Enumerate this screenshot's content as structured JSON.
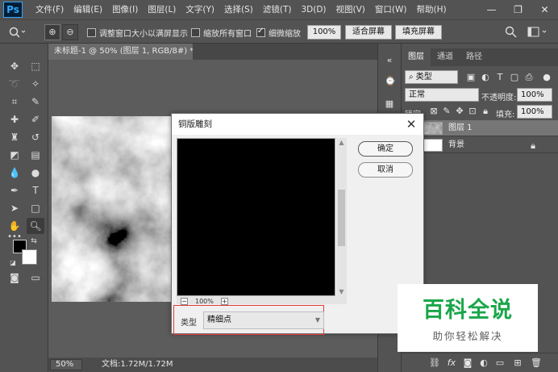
{
  "app": {
    "logo": "Ps",
    "menu": [
      "文件(F)",
      "编辑(E)",
      "图像(I)",
      "图层(L)",
      "文字(Y)",
      "选择(S)",
      "滤镜(T)",
      "3D(D)",
      "视图(V)",
      "窗口(W)",
      "帮助(H)"
    ],
    "window_controls": [
      "—",
      "❐",
      "✕"
    ]
  },
  "options_bar": {
    "resize_windows_label": "调整窗口大小以满屏显示",
    "resize_windows_checked": false,
    "zoom_all_label": "缩放所有窗口",
    "zoom_all_checked": false,
    "scrubby_zoom_label": "细微缩放",
    "scrubby_zoom_checked": true,
    "zoom_value": "100%",
    "fit_screen_label": "适合屏幕",
    "fill_screen_label": "填充屏幕"
  },
  "document": {
    "tab_title": "未标题-1 @ 50% (图层 1, RGB/8#) *",
    "zoom": "50%",
    "info": "文档:1.72M/1.72M"
  },
  "layers_panel": {
    "tabs": [
      "图层",
      "通道",
      "路径"
    ],
    "filter_kind": "类型",
    "blend_mode": "正常",
    "opacity_label": "不透明度:",
    "opacity_value": "100%",
    "lock_label": "锁定:",
    "fill_label": "填充:",
    "fill_value": "100%",
    "layers": [
      {
        "name": "图层 1",
        "selected": true
      },
      {
        "name": "背景",
        "selected": false,
        "locked": true
      }
    ],
    "bottom_icons": [
      "link-icon",
      "fx-icon",
      "mask-icon",
      "adjustment-icon",
      "folder-icon",
      "new-layer-icon",
      "trash-icon"
    ]
  },
  "dialog": {
    "title": "铜版雕刻",
    "ok_label": "确定",
    "cancel_label": "取消",
    "preview_zoom": "100%",
    "type_label": "类型",
    "type_value": "精细点"
  },
  "watermark": {
    "title": "百科全说",
    "subtitle": "助你轻松解决"
  },
  "colors": {
    "ui_dark": "#535353",
    "highlight_box": "#e43b3b",
    "watermark_green": "#1aa64a"
  }
}
